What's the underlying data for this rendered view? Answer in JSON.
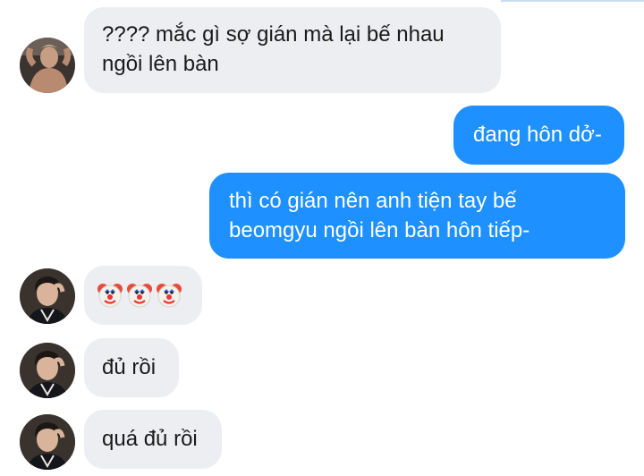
{
  "messages": [
    {
      "sender": "other",
      "text": "???? mắc gì sợ gián mà lại bế nhau ngồi lên bàn",
      "lines": [
        "???? mắc gì sợ gián mà lại bế nhau",
        "ngồi lên bàn"
      ]
    },
    {
      "sender": "me",
      "text": "đang hôn dở-"
    },
    {
      "sender": "me",
      "text": "thì có gián nên anh tiện tay bế beomgyu ngồi lên bàn hôn tiếp-",
      "lines": [
        "thì có gián nên anh tiện tay bế",
        "beomgyu ngồi lên bàn hôn tiếp-"
      ]
    },
    {
      "sender": "other",
      "emoji": [
        "clown-face",
        "clown-face",
        "clown-face"
      ]
    },
    {
      "sender": "other",
      "text": "đủ rồi"
    },
    {
      "sender": "other",
      "text": "quá đủ rồi"
    }
  ],
  "colors": {
    "incoming_bubble": "#eceef2",
    "outgoing_bubble": "#1e90ff",
    "incoming_text": "#1a1a1a",
    "outgoing_text": "#ffffff"
  }
}
